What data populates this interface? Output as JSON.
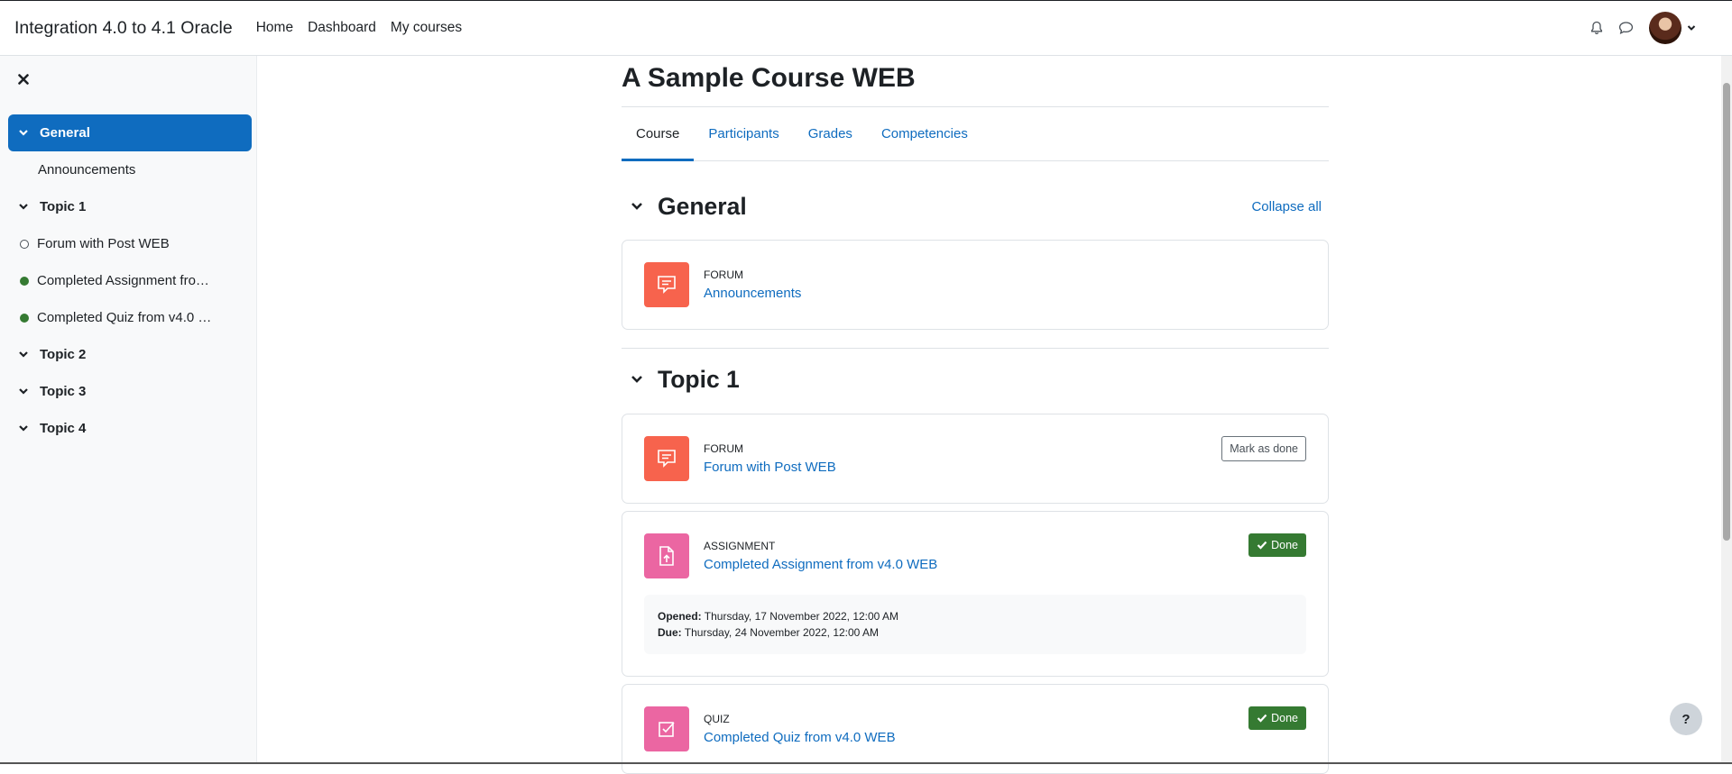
{
  "navbar": {
    "site_name": "Integration 4.0 to 4.1 Oracle",
    "links": [
      "Home",
      "Dashboard",
      "My courses"
    ]
  },
  "course_index": {
    "items": [
      {
        "type": "section",
        "label": "General",
        "active": true
      },
      {
        "type": "sub",
        "label": "Announcements"
      },
      {
        "type": "section",
        "label": "Topic 1"
      },
      {
        "type": "activity",
        "label": "Forum with Post WEB",
        "status": "open"
      },
      {
        "type": "activity",
        "label": "Completed Assignment fro…",
        "status": "done"
      },
      {
        "type": "activity",
        "label": "Completed Quiz from v4.0 …",
        "status": "done"
      },
      {
        "type": "section",
        "label": "Topic 2"
      },
      {
        "type": "section",
        "label": "Topic 3"
      },
      {
        "type": "section",
        "label": "Topic 4"
      }
    ]
  },
  "main": {
    "title": "A Sample Course WEB",
    "tabs": [
      "Course",
      "Participants",
      "Grades",
      "Competencies"
    ],
    "collapse_all": "Collapse all",
    "sections": {
      "general": {
        "title": "General",
        "activities": [
          {
            "type": "FORUM",
            "name": "Announcements"
          }
        ]
      },
      "topic1": {
        "title": "Topic 1",
        "forum": {
          "type": "FORUM",
          "name": "Forum with Post WEB",
          "button": "Mark as done"
        },
        "assignment": {
          "type": "ASSIGNMENT",
          "name": "Completed Assignment from v4.0 WEB",
          "button": "Done",
          "opened_label": "Opened:",
          "opened_value": "Thursday, 17 November 2022, 12:00 AM",
          "due_label": "Due:",
          "due_value": "Thursday, 24 November 2022, 12:00 AM"
        },
        "quiz": {
          "type": "QUIZ",
          "name": "Completed Quiz from v4.0 WEB",
          "button": "Done"
        }
      }
    }
  },
  "help": {
    "label": "?"
  },
  "colors": {
    "primary": "#0f6cbf",
    "forum_icon": "#f7634d",
    "assessment_icon": "#eb66a2",
    "done": "#357a32"
  },
  "icons": [
    "bell-icon",
    "chat-icon",
    "close-icon",
    "chevron-down-icon",
    "forum-icon",
    "assignment-icon",
    "quiz-icon",
    "check-icon"
  ]
}
